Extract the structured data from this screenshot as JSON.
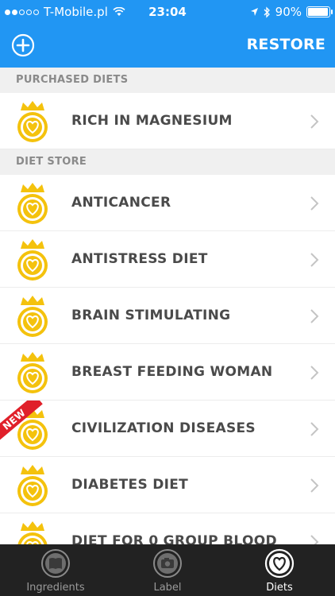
{
  "status_bar": {
    "carrier": "T-Mobile.pl",
    "time": "23:04",
    "battery": "90%"
  },
  "nav": {
    "restore_label": "RESTORE"
  },
  "sections": {
    "purchased": "PURCHASED DIETS",
    "store": "DIET STORE"
  },
  "purchased_items": [
    {
      "label": "RICH IN MAGNESIUM"
    }
  ],
  "store_items": [
    {
      "label": "ANTICANCER"
    },
    {
      "label": "ANTISTRESS DIET"
    },
    {
      "label": "BRAIN STIMULATING"
    },
    {
      "label": "BREAST FEEDING WOMAN"
    },
    {
      "label": "CIVILIZATION DISEASES",
      "tag": "NEW"
    },
    {
      "label": "DIABETES DIET"
    },
    {
      "label": "DIET FOR 0 GROUP BLOOD"
    }
  ],
  "tabs": [
    {
      "label": "Ingredients"
    },
    {
      "label": "Label"
    },
    {
      "label": "Diets"
    }
  ],
  "colors": {
    "accent": "#2196f3",
    "badge": "#f4c20d",
    "new_tag": "#e0202a",
    "tabbar": "#222222"
  }
}
